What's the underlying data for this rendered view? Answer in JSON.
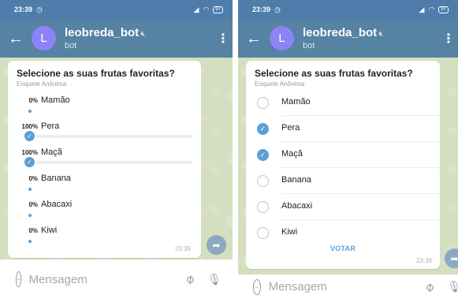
{
  "status": {
    "time": "23:39",
    "battery": "97"
  },
  "header": {
    "bot_name": "leobreda_bot",
    "bot_status": "bot",
    "avatar_letter": "L"
  },
  "poll": {
    "question": "Selecione as suas frutas favoritas?",
    "type": "Enquete Anônima",
    "vote_label": "VOTAR",
    "time": "23:39",
    "options": [
      {
        "label": "Mamão",
        "percent": "0%",
        "value": 0,
        "voted": false,
        "selected": false
      },
      {
        "label": "Pera",
        "percent": "100%",
        "value": 100,
        "voted": true,
        "selected": true
      },
      {
        "label": "Maçã",
        "percent": "100%",
        "value": 100,
        "voted": true,
        "selected": true
      },
      {
        "label": "Banana",
        "percent": "0%",
        "value": 0,
        "voted": false,
        "selected": false
      },
      {
        "label": "Abacaxi",
        "percent": "0%",
        "value": 0,
        "voted": false,
        "selected": false
      },
      {
        "label": "Kiwi",
        "percent": "0%",
        "value": 0,
        "voted": false,
        "selected": false
      }
    ]
  },
  "composer": {
    "placeholder": "Mensagem"
  },
  "colors": {
    "accent": "#5a9fd6",
    "header": "#5682a3",
    "statusbar": "#4f7cab",
    "avatar": "#8d83f7"
  }
}
